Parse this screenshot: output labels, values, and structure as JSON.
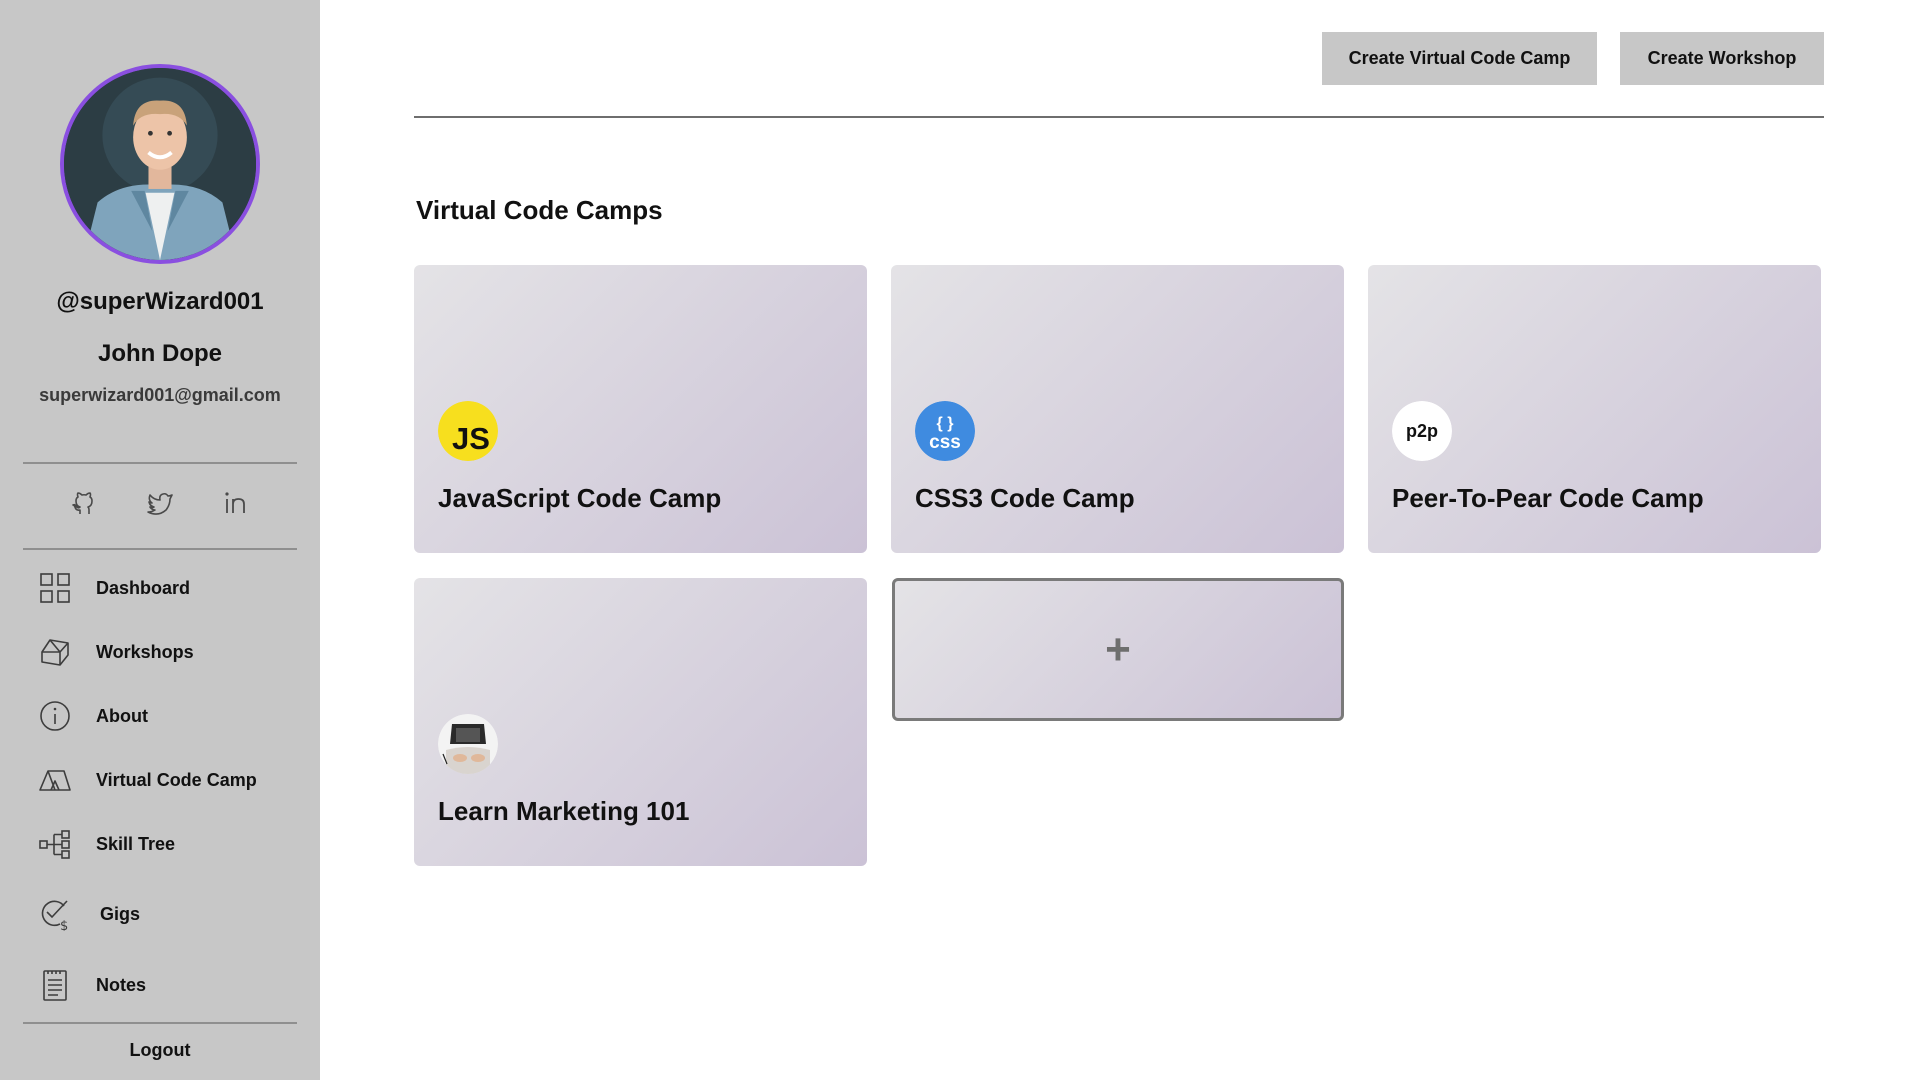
{
  "profile": {
    "handle": "@superWizard001",
    "name": "John Dope",
    "email": "superwizard001@gmail.com",
    "avatar_border_color": "#8a4fe0"
  },
  "socials": [
    {
      "icon": "github-icon"
    },
    {
      "icon": "twitter-icon"
    },
    {
      "icon": "linkedin-icon"
    }
  ],
  "nav": {
    "items": [
      {
        "label": "Dashboard",
        "icon": "dashboard-grid-icon"
      },
      {
        "label": "Workshops",
        "icon": "workshops-icon"
      },
      {
        "label": "About",
        "icon": "info-icon"
      },
      {
        "label": "Virtual Code Camp",
        "icon": "tent-icon"
      },
      {
        "label": "Skill Tree",
        "icon": "skill-tree-icon"
      },
      {
        "label": "Gigs",
        "icon": "gigs-dollar-icon"
      },
      {
        "label": "Notes",
        "icon": "notes-icon"
      }
    ],
    "logout_label": "Logout"
  },
  "header": {
    "create_camp_label": "Create Virtual Code Camp",
    "create_workshop_label": "Create Workshop"
  },
  "main": {
    "section_title": "Virtual Code Camps",
    "cards": [
      {
        "title": "JavaScript Code Camp",
        "icon": "javascript-logo-icon",
        "logo_text": "JS",
        "logo_color": "#f7df1e"
      },
      {
        "title": "CSS3 Code Camp",
        "icon": "css-logo-icon",
        "logo_text": "css",
        "logo_braces": "{ }",
        "logo_color": "#3f8be0"
      },
      {
        "title": "Peer-To-Pear Code Camp",
        "icon": "peer-to-pear-logo-icon",
        "logo_text": "p2p",
        "logo_color": "#ffffff"
      },
      {
        "title": "Learn Marketing 101",
        "icon": "laptop-photo-icon"
      }
    ],
    "add_label": "+"
  }
}
